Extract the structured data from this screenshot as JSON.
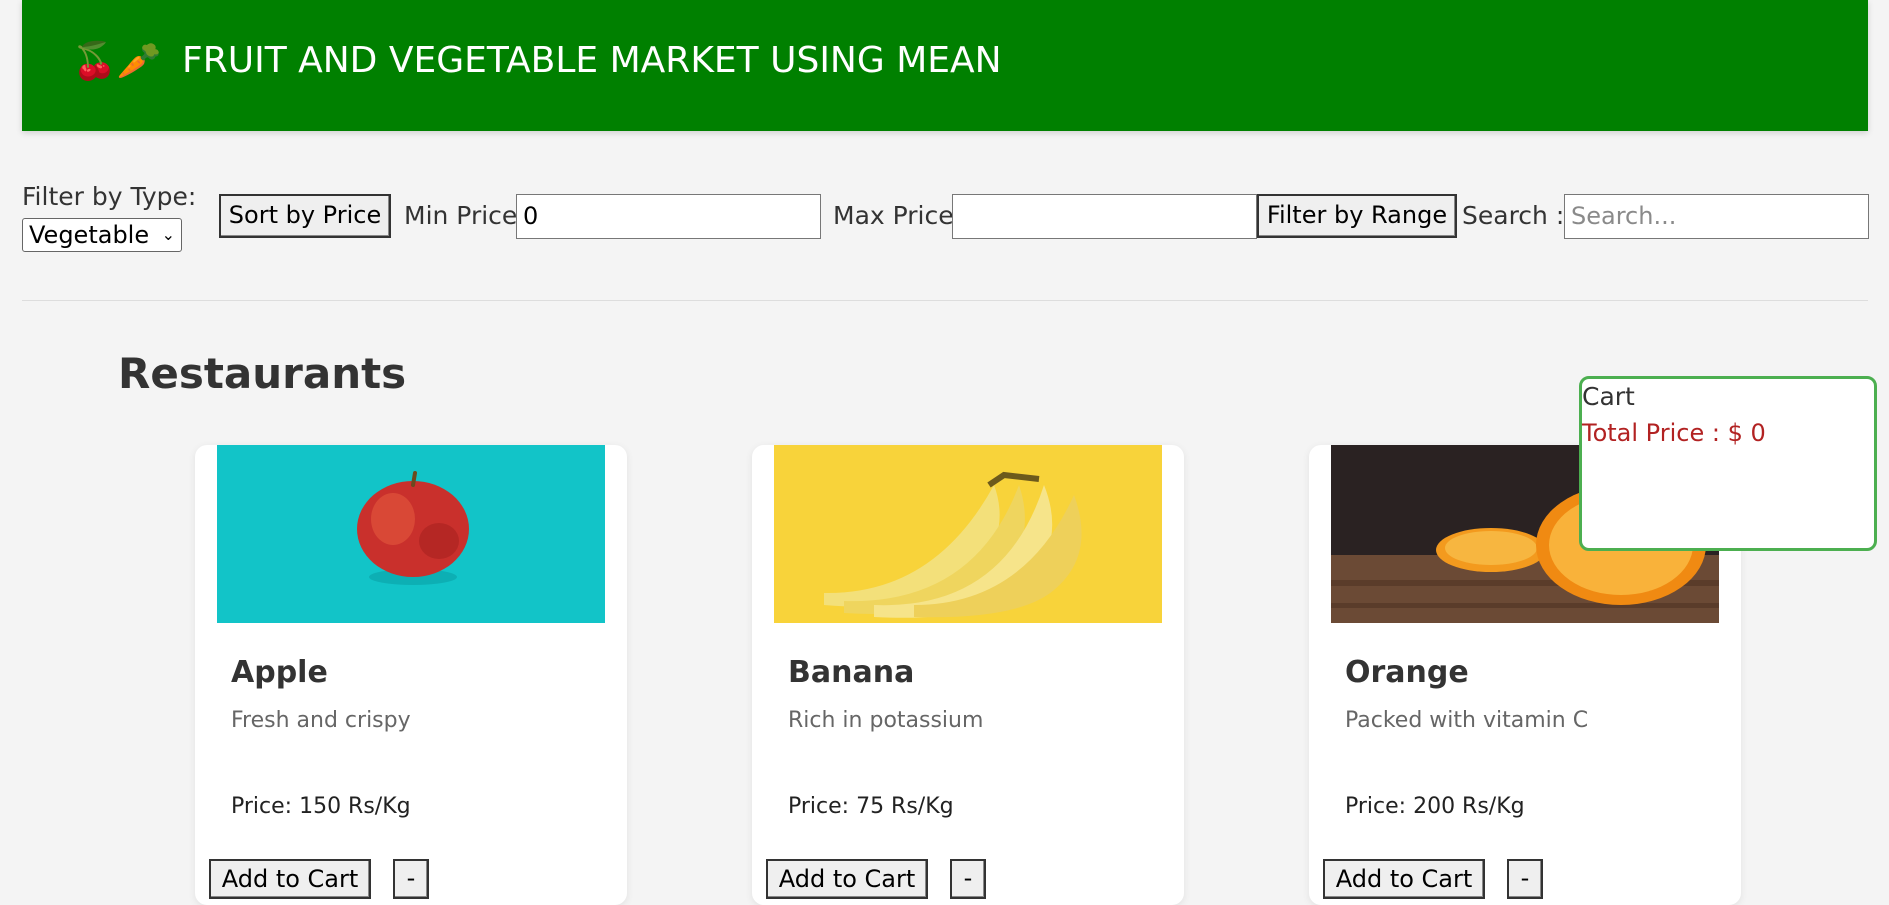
{
  "header": {
    "emoji": "🍒🥕",
    "title": "FRUIT AND VEGETABLE MARKET USING MEAN"
  },
  "filters": {
    "type_label": "Filter by Type:",
    "type_value": "Vegetable",
    "sort_button": "Sort by Price",
    "min_label": "Min Price:",
    "min_value": "0",
    "max_label": "Max Price:",
    "max_value": "",
    "range_button": "Filter by Range",
    "search_label": "Search :",
    "search_placeholder": "Search..."
  },
  "section_title": "Restaurants",
  "products": [
    {
      "name": "Apple",
      "description": "Fresh and crispy",
      "price": "Price: 150 Rs/Kg",
      "add_label": "Add to Cart",
      "minus_label": "-"
    },
    {
      "name": "Banana",
      "description": "Rich in potassium",
      "price": "Price: 75 Rs/Kg",
      "add_label": "Add to Cart",
      "minus_label": "-"
    },
    {
      "name": "Orange",
      "description": "Packed with vitamin C",
      "price": "Price: 200 Rs/Kg",
      "add_label": "Add to Cart",
      "minus_label": "-"
    }
  ],
  "cart": {
    "label": "Cart",
    "total": "Total Price : $ 0"
  },
  "colors": {
    "header_bg": "#008000",
    "cart_border": "#4caf50",
    "total_text": "#b22222"
  }
}
